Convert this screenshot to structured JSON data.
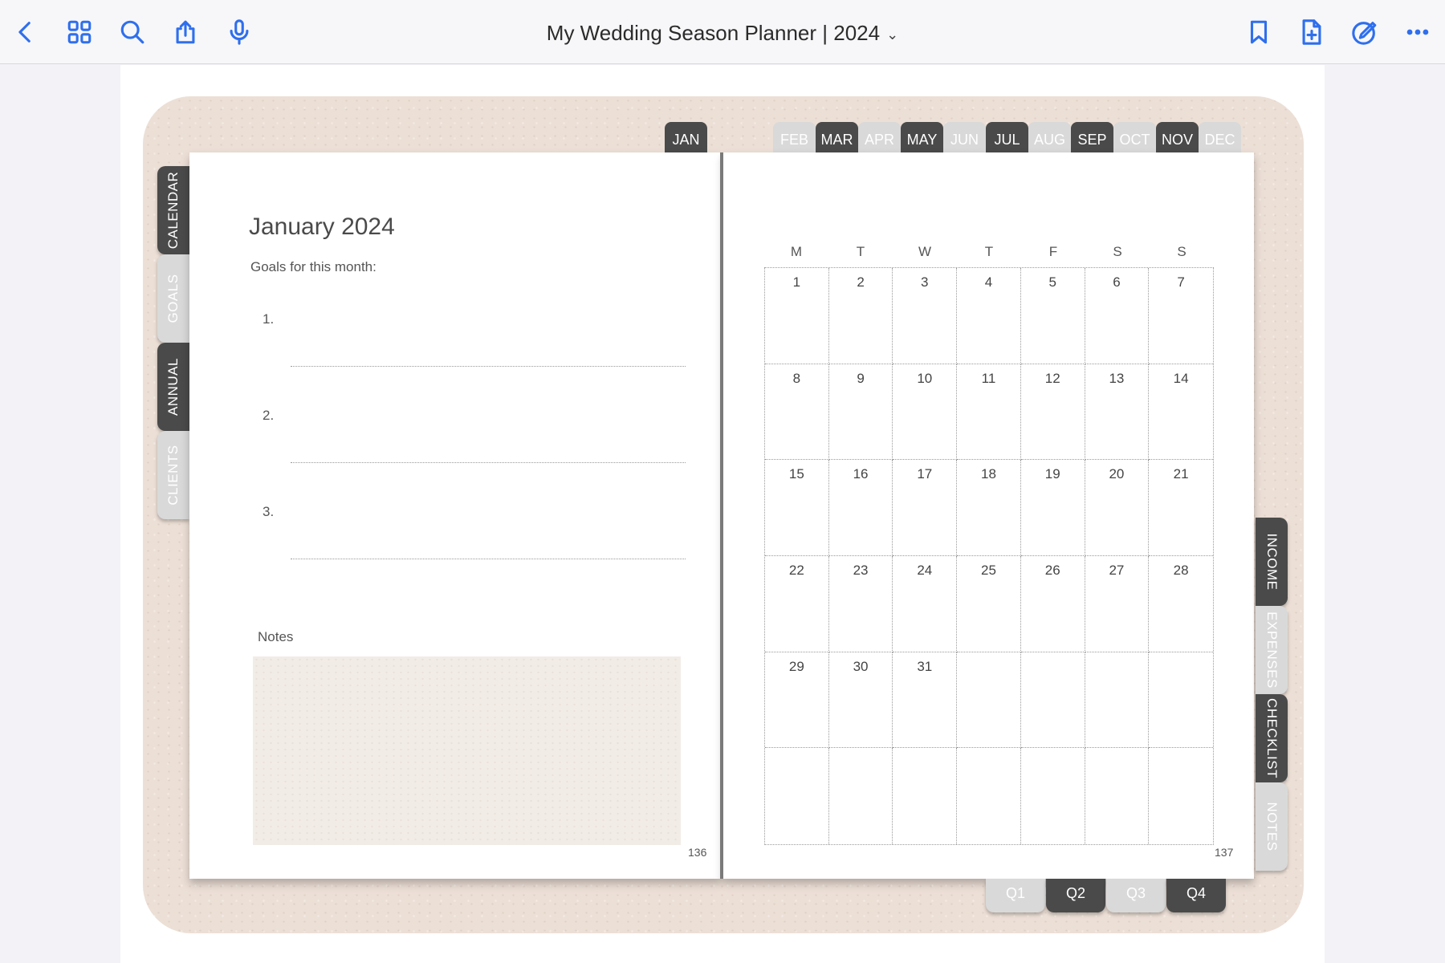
{
  "toolbar": {
    "title": "My Wedding Season Planner | 2024",
    "title_chevron": "⌄",
    "icons": [
      "back-icon",
      "thumbnails-icon",
      "search-icon",
      "share-icon",
      "microphone-icon",
      "bookmark-icon",
      "add-page-icon",
      "markup-icon",
      "more-icon"
    ]
  },
  "month_tabs": [
    "JAN",
    "FEB",
    "MAR",
    "APR",
    "MAY",
    "JUN",
    "JUL",
    "AUG",
    "SEP",
    "OCT",
    "NOV",
    "DEC"
  ],
  "left_tabs": [
    "CALENDAR",
    "GOALS",
    "ANNUAL",
    "CLIENTS"
  ],
  "right_tabs": [
    "INCOME",
    "EXPENSES",
    "CHECKLIST",
    "NOTES"
  ],
  "quarter_tabs": [
    "Q1",
    "Q2",
    "Q3",
    "Q4"
  ],
  "left_page": {
    "title": "January 2024",
    "goals_label": "Goals for this month:",
    "goals": [
      "1.",
      "2.",
      "3."
    ],
    "notes_label": "Notes",
    "page_number": "136"
  },
  "right_page": {
    "weekdays": [
      "M",
      "T",
      "W",
      "T",
      "F",
      "S",
      "S"
    ],
    "days": [
      "1",
      "2",
      "3",
      "4",
      "5",
      "6",
      "7",
      "8",
      "9",
      "10",
      "11",
      "12",
      "13",
      "14",
      "15",
      "16",
      "17",
      "18",
      "19",
      "20",
      "21",
      "22",
      "23",
      "24",
      "25",
      "26",
      "27",
      "28",
      "29",
      "30",
      "31",
      "",
      "",
      "",
      "",
      "",
      "",
      "",
      "",
      "",
      "",
      ""
    ],
    "page_number": "137"
  },
  "colors": {
    "accent": "#2f6fed",
    "tab_dark": "#4a4a4a",
    "tab_light": "#d9d9d9",
    "cover": "#ecdfd6"
  }
}
